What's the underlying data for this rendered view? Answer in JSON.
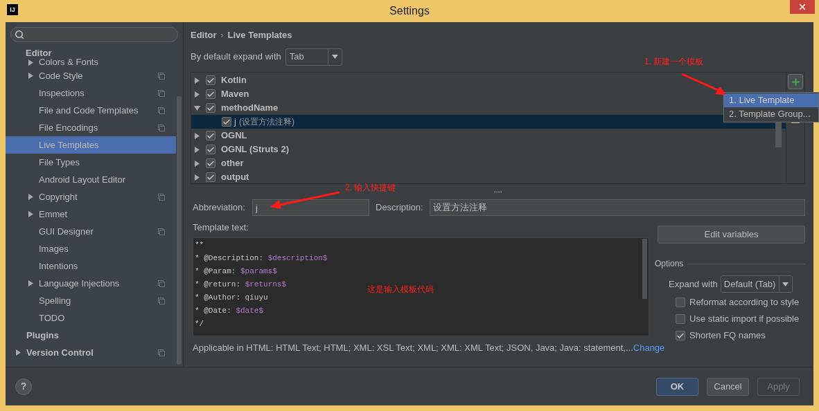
{
  "window": {
    "title": "Settings",
    "app_icon": "IJ"
  },
  "sidebar": {
    "tree": [
      {
        "label": "Editor",
        "selected": false,
        "children": [
          {
            "label": "Colors & Fonts",
            "expanded": false,
            "project_icon": false,
            "selected": false,
            "partially_hidden": true
          },
          {
            "label": "Code Style",
            "expanded": false,
            "project_icon": true,
            "selected": false
          },
          {
            "label": "Inspections",
            "project_icon": true,
            "selected": false
          },
          {
            "label": "File and Code Templates",
            "project_icon": true,
            "selected": false
          },
          {
            "label": "File Encodings",
            "project_icon": true,
            "selected": false
          },
          {
            "label": "Live Templates",
            "project_icon": false,
            "selected": true
          },
          {
            "label": "File Types",
            "project_icon": false,
            "selected": false
          },
          {
            "label": "Android Layout Editor",
            "project_icon": false,
            "selected": false
          },
          {
            "label": "Copyright",
            "expanded": false,
            "project_icon": true,
            "selected": false
          },
          {
            "label": "Emmet",
            "expanded": false,
            "project_icon": false,
            "selected": false
          },
          {
            "label": "GUI Designer",
            "project_icon": true,
            "selected": false
          },
          {
            "label": "Images",
            "project_icon": false,
            "selected": false
          },
          {
            "label": "Intentions",
            "project_icon": false,
            "selected": false
          },
          {
            "label": "Language Injections",
            "expanded": false,
            "project_icon": true,
            "selected": false
          },
          {
            "label": "Spelling",
            "project_icon": true,
            "selected": false
          },
          {
            "label": "TODO",
            "project_icon": false,
            "selected": false
          }
        ]
      },
      {
        "label": "Plugins",
        "project_icon": false,
        "selected": false
      },
      {
        "label": "Version Control",
        "expanded": false,
        "project_icon": true,
        "selected": false
      }
    ]
  },
  "breadcrumb": [
    "Editor",
    "Live Templates"
  ],
  "breadcrumb_separator": "›",
  "expand_default": {
    "label": "By default expand with",
    "value": "Tab"
  },
  "template_tree": {
    "groups": [
      {
        "label": "Kotlin",
        "checked": true,
        "expanded": false,
        "selected": false
      },
      {
        "label": "Maven",
        "checked": true,
        "expanded": false,
        "selected": false
      },
      {
        "label": "methodName",
        "checked": true,
        "expanded": true,
        "selected": false,
        "children": [
          {
            "abbreviation": "j",
            "description": "(设置方法注释)",
            "checked": true,
            "selected": true
          }
        ]
      },
      {
        "label": "OGNL",
        "checked": true,
        "expanded": false,
        "selected": false
      },
      {
        "label": "OGNL (Struts 2)",
        "checked": true,
        "expanded": false,
        "selected": false
      },
      {
        "label": "other",
        "checked": true,
        "expanded": false,
        "selected": false
      },
      {
        "label": "output",
        "checked": true,
        "expanded": false,
        "selected": false
      }
    ]
  },
  "add_menu": {
    "items": [
      {
        "label": "1. Live Template",
        "selected": true
      },
      {
        "label": "2. Template Group...",
        "selected": false
      }
    ]
  },
  "abbreviation": {
    "label": "Abbreviation:",
    "value": "j"
  },
  "description": {
    "label": "Description:",
    "value": "设置方法注释"
  },
  "template_text": {
    "label": "Template text:",
    "lines": [
      [
        {
          "kind": "plain",
          "text": "**"
        }
      ],
      [
        {
          "kind": "plain",
          "text": "* @Description: "
        },
        {
          "kind": "variable",
          "text": "$description$"
        }
      ],
      [
        {
          "kind": "plain",
          "text": "* @Param: "
        },
        {
          "kind": "variable",
          "text": "$params$"
        }
      ],
      [
        {
          "kind": "plain",
          "text": "* @return: "
        },
        {
          "kind": "variable",
          "text": "$returns$"
        }
      ],
      [
        {
          "kind": "plain",
          "text": "* @Author: qiuyu"
        }
      ],
      [
        {
          "kind": "plain",
          "text": "* @Date: "
        },
        {
          "kind": "variable",
          "text": "$date$"
        }
      ],
      [
        {
          "kind": "plain",
          "text": "*/"
        }
      ]
    ]
  },
  "applicable": {
    "text": "Applicable in HTML: HTML Text; HTML; XML: XSL Text; XML; XML: XML Text; JSON, Java; Java: statement,...",
    "link": "Change"
  },
  "edit_variables": "Edit variables",
  "options": {
    "title": "Options",
    "expand_with": {
      "label": "Expand with",
      "value": "Default (Tab)"
    },
    "checkboxes": [
      {
        "label": "Reformat according to style",
        "checked": false
      },
      {
        "label": "Use static import if possible",
        "checked": false
      },
      {
        "label": "Shorten FQ names",
        "checked": true
      }
    ]
  },
  "help": "?",
  "buttons": [
    {
      "label": "OK",
      "kind": "default",
      "disabled": false
    },
    {
      "label": "Cancel",
      "kind": "normal",
      "disabled": false
    },
    {
      "label": "Apply",
      "kind": "normal",
      "disabled": true
    }
  ],
  "annotations": [
    {
      "text": "1. 新建一个模板"
    },
    {
      "text": "2. 输入快捷键"
    },
    {
      "text": "这是输入模板代码"
    }
  ]
}
